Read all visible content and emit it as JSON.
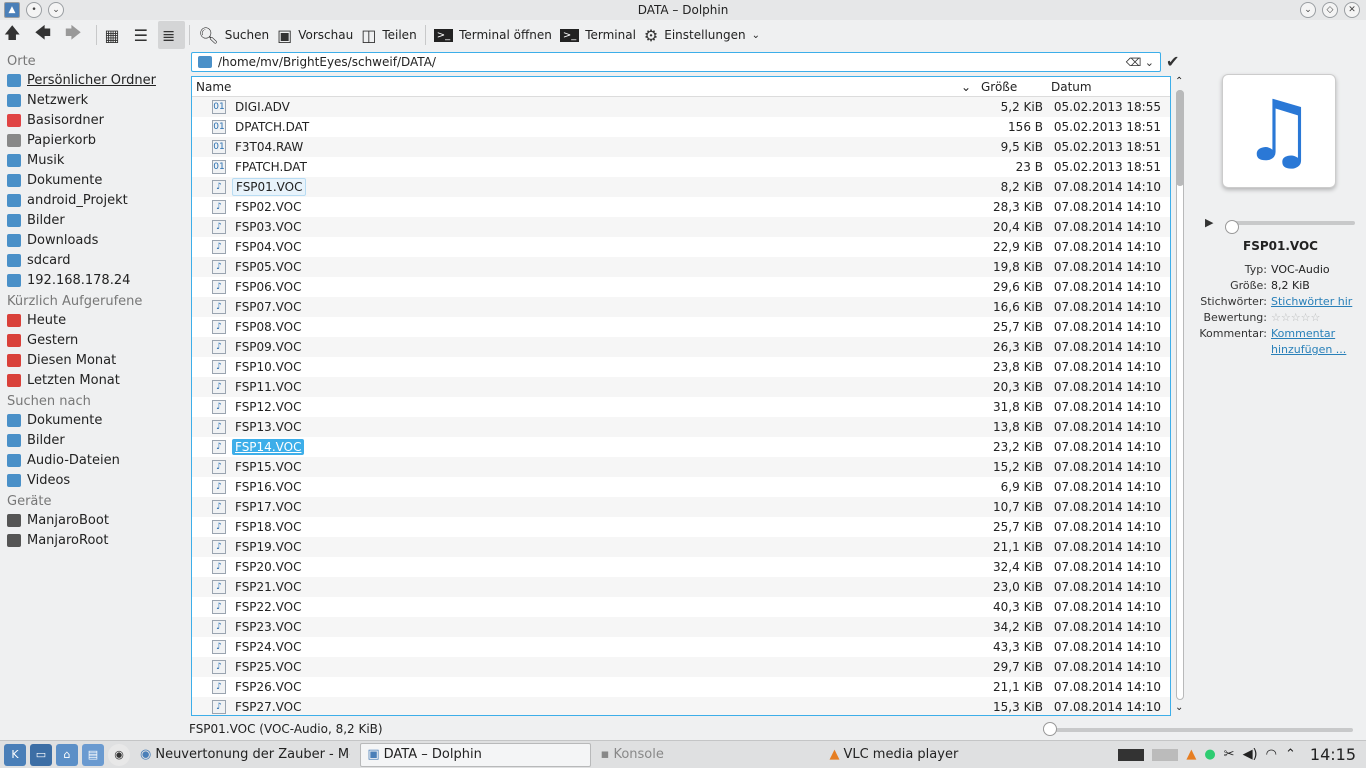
{
  "window": {
    "title": "DATA – Dolphin"
  },
  "toolbar": {
    "search": "Suchen",
    "preview": "Vorschau",
    "split": "Teilen",
    "open_terminal": "Terminal öffnen",
    "terminal": "Terminal",
    "settings": "Einstellungen"
  },
  "places": {
    "orte_header": "Orte",
    "orte": [
      "Persönlicher Ordner",
      "Netzwerk",
      "Basisordner",
      "Papierkorb",
      "Musik",
      "Dokumente",
      "android_Projekt",
      "Bilder",
      "Downloads",
      "sdcard",
      "192.168.178.24"
    ],
    "recent_header": "Kürzlich Aufgerufene",
    "recent": [
      "Heute",
      "Gestern",
      "Diesen Monat",
      "Letzten Monat"
    ],
    "search_header": "Suchen nach",
    "search": [
      "Dokumente",
      "Bilder",
      "Audio-Dateien",
      "Videos"
    ],
    "devices_header": "Geräte",
    "devices": [
      "ManjaroBoot",
      "ManjaroRoot"
    ]
  },
  "location": {
    "path": "/home/mv/BrightEyes/schweif/DATA/"
  },
  "columns": {
    "name": "Name",
    "size": "Größe",
    "date": "Datum"
  },
  "files": [
    {
      "name": "DIGI.ADV",
      "size": "5,2 KiB",
      "date": "05.02.2013 18:55"
    },
    {
      "name": "DPATCH.DAT",
      "size": "156 B",
      "date": "05.02.2013 18:51"
    },
    {
      "name": "F3T04.RAW",
      "size": "9,5 KiB",
      "date": "05.02.2013 18:51"
    },
    {
      "name": "FPATCH.DAT",
      "size": "23 B",
      "date": "05.02.2013 18:51"
    },
    {
      "name": "FSP01.VOC",
      "size": "8,2 KiB",
      "date": "07.08.2014 14:10"
    },
    {
      "name": "FSP02.VOC",
      "size": "28,3 KiB",
      "date": "07.08.2014 14:10"
    },
    {
      "name": "FSP03.VOC",
      "size": "20,4 KiB",
      "date": "07.08.2014 14:10"
    },
    {
      "name": "FSP04.VOC",
      "size": "22,9 KiB",
      "date": "07.08.2014 14:10"
    },
    {
      "name": "FSP05.VOC",
      "size": "19,8 KiB",
      "date": "07.08.2014 14:10"
    },
    {
      "name": "FSP06.VOC",
      "size": "29,6 KiB",
      "date": "07.08.2014 14:10"
    },
    {
      "name": "FSP07.VOC",
      "size": "16,6 KiB",
      "date": "07.08.2014 14:10"
    },
    {
      "name": "FSP08.VOC",
      "size": "25,7 KiB",
      "date": "07.08.2014 14:10"
    },
    {
      "name": "FSP09.VOC",
      "size": "26,3 KiB",
      "date": "07.08.2014 14:10"
    },
    {
      "name": "FSP10.VOC",
      "size": "23,8 KiB",
      "date": "07.08.2014 14:10"
    },
    {
      "name": "FSP11.VOC",
      "size": "20,3 KiB",
      "date": "07.08.2014 14:10"
    },
    {
      "name": "FSP12.VOC",
      "size": "31,8 KiB",
      "date": "07.08.2014 14:10"
    },
    {
      "name": "FSP13.VOC",
      "size": "13,8 KiB",
      "date": "07.08.2014 14:10"
    },
    {
      "name": "FSP14.VOC",
      "size": "23,2 KiB",
      "date": "07.08.2014 14:10"
    },
    {
      "name": "FSP15.VOC",
      "size": "15,2 KiB",
      "date": "07.08.2014 14:10"
    },
    {
      "name": "FSP16.VOC",
      "size": "6,9 KiB",
      "date": "07.08.2014 14:10"
    },
    {
      "name": "FSP17.VOC",
      "size": "10,7 KiB",
      "date": "07.08.2014 14:10"
    },
    {
      "name": "FSP18.VOC",
      "size": "25,7 KiB",
      "date": "07.08.2014 14:10"
    },
    {
      "name": "FSP19.VOC",
      "size": "21,1 KiB",
      "date": "07.08.2014 14:10"
    },
    {
      "name": "FSP20.VOC",
      "size": "32,4 KiB",
      "date": "07.08.2014 14:10"
    },
    {
      "name": "FSP21.VOC",
      "size": "23,0 KiB",
      "date": "07.08.2014 14:10"
    },
    {
      "name": "FSP22.VOC",
      "size": "40,3 KiB",
      "date": "07.08.2014 14:10"
    },
    {
      "name": "FSP23.VOC",
      "size": "34,2 KiB",
      "date": "07.08.2014 14:10"
    },
    {
      "name": "FSP24.VOC",
      "size": "43,3 KiB",
      "date": "07.08.2014 14:10"
    },
    {
      "name": "FSP25.VOC",
      "size": "29,7 KiB",
      "date": "07.08.2014 14:10"
    },
    {
      "name": "FSP26.VOC",
      "size": "21,1 KiB",
      "date": "07.08.2014 14:10"
    },
    {
      "name": "FSP27.VOC",
      "size": "15,3 KiB",
      "date": "07.08.2014 14:10"
    }
  ],
  "info": {
    "name": "FSP01.VOC",
    "type_label": "Typ:",
    "type_value": "VOC-Audio",
    "size_label": "Größe:",
    "size_value": "8,2 KiB",
    "tags_label": "Stichwörter:",
    "tags_value": "Stichwörter hir",
    "rating_label": "Bewertung:",
    "rating_stars": "☆☆☆☆☆",
    "comment_label": "Kommentar:",
    "comment_value1": "Kommentar",
    "comment_value2": "hinzufügen ..."
  },
  "status": {
    "text": "FSP01.VOC (VOC-Audio, 8,2 KiB)"
  },
  "taskbar": {
    "tasks": [
      "Neuvertonung der Zauber - Mo",
      "DATA – Dolphin",
      "Konsole",
      "VLC media player"
    ],
    "clock": "14:15"
  }
}
